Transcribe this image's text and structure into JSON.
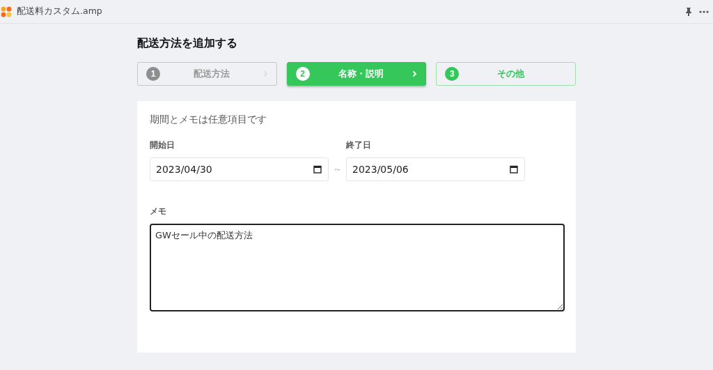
{
  "window": {
    "title": "配送料カスタム.amp"
  },
  "heading": "配送方法を追加する",
  "steps": [
    {
      "number": "1",
      "label": "配送方法",
      "kind": "past",
      "chevron": true
    },
    {
      "number": "2",
      "label": "名称・説明",
      "kind": "current",
      "chevron": true
    },
    {
      "number": "3",
      "label": "その他",
      "kind": "next",
      "chevron": false
    }
  ],
  "form": {
    "note": "期間とメモは任意項目です",
    "start": {
      "label": "開始日",
      "value": "2023/04/30"
    },
    "separator": "～",
    "end": {
      "label": "終了日",
      "value": "2023/05/06"
    },
    "memo": {
      "label": "メモ",
      "value": "GWセール中の配送方法"
    }
  }
}
